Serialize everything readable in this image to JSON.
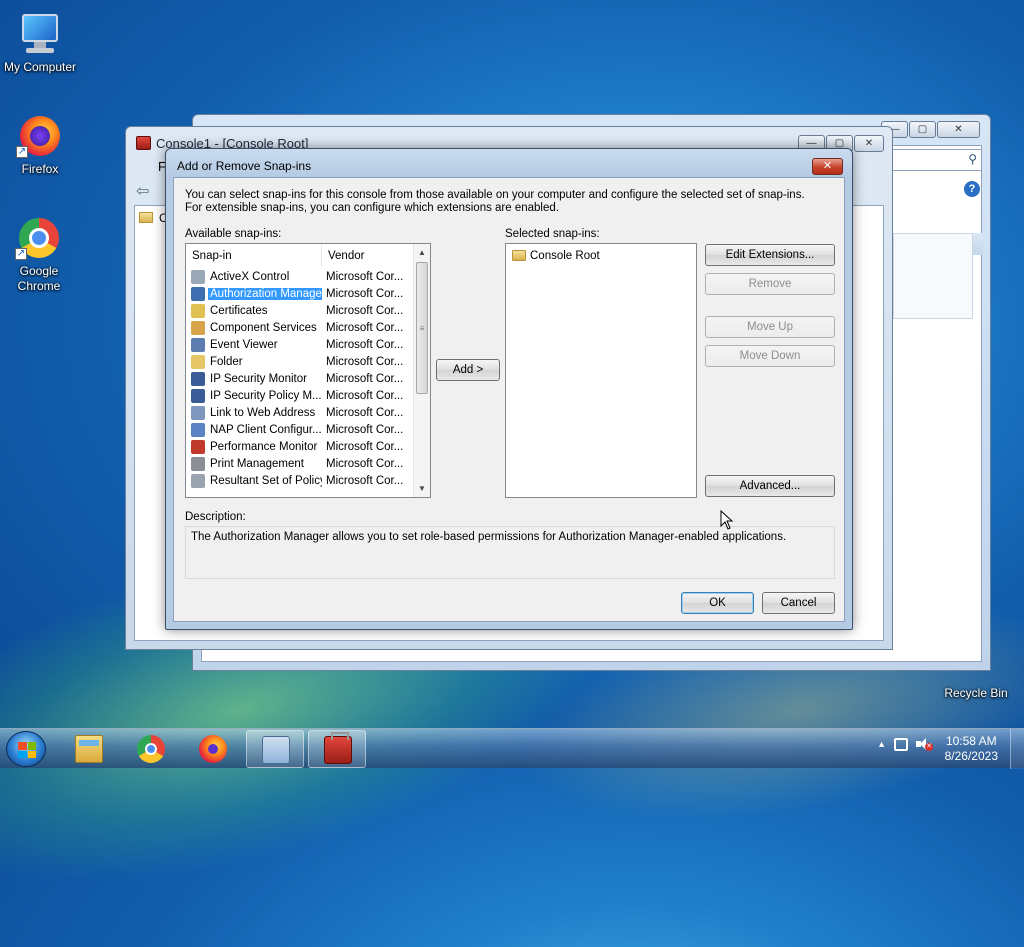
{
  "desktop": {
    "icons": [
      {
        "label": "My Computer"
      },
      {
        "label": "Firefox"
      },
      {
        "label": "Google Chrome"
      },
      {
        "label": "Recycle Bin"
      }
    ]
  },
  "bg_windows": {
    "console_title": "Console1 - [Console Root]",
    "menu_initial": "F",
    "tree_initial": "C"
  },
  "dialog": {
    "title": "Add or Remove Snap-ins",
    "close_label": "✕",
    "intro": "You can select snap-ins for this console from those available on your computer and configure the selected set of snap-ins. For extensible snap-ins, you can configure which extensions are enabled.",
    "available_label": "Available snap-ins:",
    "selected_label": "Selected snap-ins:",
    "columns": {
      "snapin": "Snap-in",
      "vendor": "Vendor"
    },
    "snapins": [
      {
        "name": "ActiveX Control",
        "vendor": "Microsoft Cor...",
        "icon": "activex-icon",
        "color": "#9aa7b5"
      },
      {
        "name": "Authorization Manager",
        "vendor": "Microsoft Cor...",
        "icon": "authorization-manager-icon",
        "color": "#3f6fb0",
        "selected": true
      },
      {
        "name": "Certificates",
        "vendor": "Microsoft Cor...",
        "icon": "certificates-icon",
        "color": "#e0c050"
      },
      {
        "name": "Component Services",
        "vendor": "Microsoft Cor...",
        "icon": "component-services-icon",
        "color": "#d8a64a"
      },
      {
        "name": "Event Viewer",
        "vendor": "Microsoft Cor...",
        "icon": "event-viewer-icon",
        "color": "#5b7db0"
      },
      {
        "name": "Folder",
        "vendor": "Microsoft Cor...",
        "icon": "folder-icon",
        "color": "#e5c768"
      },
      {
        "name": "IP Security Monitor",
        "vendor": "Microsoft Cor...",
        "icon": "ip-security-monitor-icon",
        "color": "#3b5c96"
      },
      {
        "name": "IP Security Policy M...",
        "vendor": "Microsoft Cor...",
        "icon": "ip-security-policy-icon",
        "color": "#3b5c96"
      },
      {
        "name": "Link to Web Address",
        "vendor": "Microsoft Cor...",
        "icon": "web-link-icon",
        "color": "#7e98bd"
      },
      {
        "name": "NAP Client Configur...",
        "vendor": "Microsoft Cor...",
        "icon": "nap-client-icon",
        "color": "#5a83c3"
      },
      {
        "name": "Performance Monitor",
        "vendor": "Microsoft Cor...",
        "icon": "performance-monitor-icon",
        "color": "#c0392b"
      },
      {
        "name": "Print Management",
        "vendor": "Microsoft Cor...",
        "icon": "print-management-icon",
        "color": "#8b8f95"
      },
      {
        "name": "Resultant Set of Policy",
        "vendor": "Microsoft Cor...",
        "icon": "rsop-icon",
        "color": "#9aa4b0"
      }
    ],
    "selected_items": [
      {
        "name": "Console Root",
        "icon": "folder-icon"
      }
    ],
    "add_button": "Add >",
    "buttons": {
      "edit_extensions": "Edit Extensions...",
      "remove": "Remove",
      "move_up": "Move Up",
      "move_down": "Move Down",
      "advanced": "Advanced..."
    },
    "description_label": "Description:",
    "description": "The Authorization Manager allows you to set role-based permissions for Authorization Manager-enabled applications.",
    "ok": "OK",
    "cancel": "Cancel"
  },
  "taskbar": {
    "clock_time": "10:58 AM",
    "clock_date": "8/26/2023",
    "tray_arrow": "▲"
  }
}
